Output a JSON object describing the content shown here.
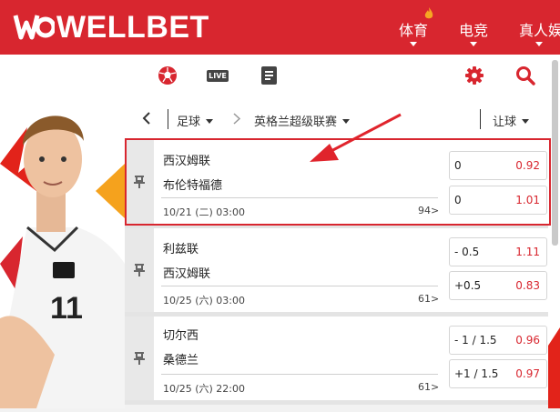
{
  "brand": {
    "logo_text": "WELLBET",
    "accent": "#d8262f"
  },
  "nav": {
    "items": [
      "体育",
      "电竞",
      "真人娱"
    ]
  },
  "toolbar": {
    "icons": [
      "soccer-ball-icon",
      "live-icon",
      "document-icon",
      "gear-icon",
      "search-icon"
    ],
    "live_label": "LIVE"
  },
  "filter": {
    "sport": "足球",
    "league": "英格兰超级联赛",
    "market": "让球"
  },
  "matches": [
    {
      "home": "西汉姆联",
      "away": "布伦特福德",
      "time": "10/21 (二) 03:00",
      "count": "94>",
      "odds": [
        {
          "handicap": "0",
          "price": "0.92"
        },
        {
          "handicap": "0",
          "price": "1.01"
        }
      ]
    },
    {
      "home": "利兹联",
      "away": "西汉姆联",
      "time": "10/25 (六) 03:00",
      "count": "61>",
      "odds": [
        {
          "handicap": "- 0.5",
          "price": "1.11"
        },
        {
          "handicap": "+0.5",
          "price": "0.83"
        }
      ]
    },
    {
      "home": "切尔西",
      "away": "桑德兰",
      "time": "10/25 (六) 22:00",
      "count": "61>",
      "odds": [
        {
          "handicap": "- 1 / 1.5",
          "price": "0.96"
        },
        {
          "handicap": "+1 / 1.5",
          "price": "0.97"
        }
      ]
    }
  ]
}
